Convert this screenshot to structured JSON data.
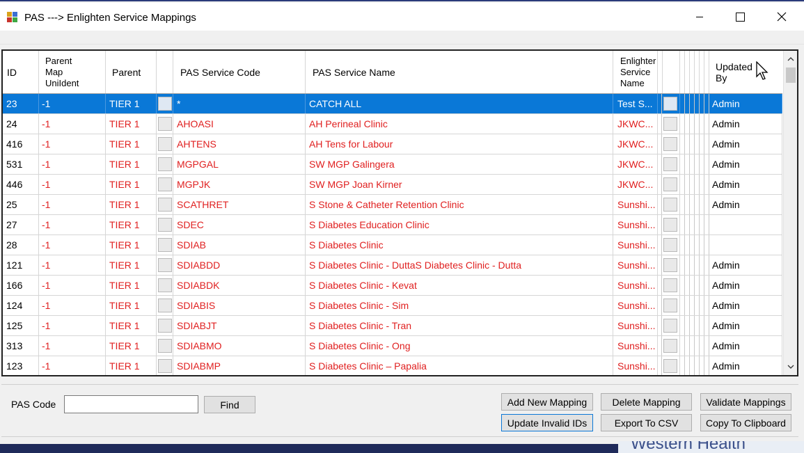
{
  "window": {
    "title": "PAS ---> Enlighten Service Mappings"
  },
  "grid": {
    "headers": {
      "id": "ID",
      "parent_map_l1": "Parent",
      "parent_map_l2": "Map",
      "parent_map_l3": "UniIdent",
      "parent": "Parent",
      "pas_service_code": "PAS Service Code",
      "pas_service_name": "PAS Service Name",
      "enlighten_l1": "Enlighter",
      "enlighten_l2": "Service",
      "enlighten_l3": "Name",
      "updated_by_l1": "Updated",
      "updated_by_l2": "By"
    },
    "rows": [
      {
        "id": "23",
        "parent_map": "-1",
        "parent": "TIER 1",
        "code": "*",
        "name": "CATCH ALL",
        "enlighten": "Test S...",
        "updated_by": "Admin"
      },
      {
        "id": "24",
        "parent_map": "-1",
        "parent": "TIER 1",
        "code": "AHOASI",
        "name": "AH Perineal Clinic",
        "enlighten": "JKWC...",
        "updated_by": "Admin"
      },
      {
        "id": "416",
        "parent_map": "-1",
        "parent": "TIER 1",
        "code": "AHTENS",
        "name": "AH Tens for Labour",
        "enlighten": "JKWC...",
        "updated_by": "Admin"
      },
      {
        "id": "531",
        "parent_map": "-1",
        "parent": "TIER 1",
        "code": "MGPGAL",
        "name": "SW MGP Galingera",
        "enlighten": "JKWC...",
        "updated_by": "Admin"
      },
      {
        "id": "446",
        "parent_map": "-1",
        "parent": "TIER 1",
        "code": "MGPJK",
        "name": "SW MGP Joan Kirner",
        "enlighten": "JKWC...",
        "updated_by": "Admin"
      },
      {
        "id": "25",
        "parent_map": "-1",
        "parent": "TIER 1",
        "code": "SCATHRET",
        "name": "S Stone & Catheter Retention Clinic",
        "enlighten": "Sunshi...",
        "updated_by": "Admin"
      },
      {
        "id": "27",
        "parent_map": "-1",
        "parent": "TIER 1",
        "code": "SDEC",
        "name": "S Diabetes Education Clinic",
        "enlighten": "Sunshi...",
        "updated_by": ""
      },
      {
        "id": "28",
        "parent_map": "-1",
        "parent": "TIER 1",
        "code": "SDIAB",
        "name": "S Diabetes Clinic",
        "enlighten": "Sunshi...",
        "updated_by": ""
      },
      {
        "id": "121",
        "parent_map": "-1",
        "parent": "TIER 1",
        "code": "SDIABDD",
        "name": "S Diabetes Clinic - DuttaS Diabetes Clinic - Dutta",
        "enlighten": "Sunshi...",
        "updated_by": "Admin"
      },
      {
        "id": "166",
        "parent_map": "-1",
        "parent": "TIER 1",
        "code": "SDIABDK",
        "name": "S Diabetes Clinic - Kevat",
        "enlighten": "Sunshi...",
        "updated_by": "Admin"
      },
      {
        "id": "124",
        "parent_map": "-1",
        "parent": "TIER 1",
        "code": "SDIABIS",
        "name": "S Diabetes Clinic - Sim",
        "enlighten": "Sunshi...",
        "updated_by": "Admin"
      },
      {
        "id": "125",
        "parent_map": "-1",
        "parent": "TIER 1",
        "code": "SDIABJT",
        "name": "S Diabetes Clinic - Tran",
        "enlighten": "Sunshi...",
        "updated_by": "Admin"
      },
      {
        "id": "313",
        "parent_map": "-1",
        "parent": "TIER 1",
        "code": "SDIABMO",
        "name": "S Diabetes Clinic - Ong",
        "enlighten": "Sunshi...",
        "updated_by": "Admin"
      },
      {
        "id": "123",
        "parent_map": "-1",
        "parent": "TIER 1",
        "code": "SDIABMP",
        "name": "S Diabetes Clinic – Papalia",
        "enlighten": "Sunshi...",
        "updated_by": "Admin"
      }
    ]
  },
  "search": {
    "label": "PAS Code",
    "value": "",
    "find_button": "Find"
  },
  "actions": {
    "add_new_mapping": "Add New Mapping",
    "delete_mapping": "Delete Mapping",
    "validate_mappings": "Validate Mappings",
    "update_invalid_ids": "Update Invalid IDs",
    "export_to_csv": "Export To CSV",
    "copy_to_clipboard": "Copy To Clipboard"
  },
  "background": {
    "watermark_text": "Western Health"
  },
  "colors": {
    "selected_row": "#0a78d7",
    "row_text": "#e02020",
    "window_bg": "#f0f0f0"
  }
}
